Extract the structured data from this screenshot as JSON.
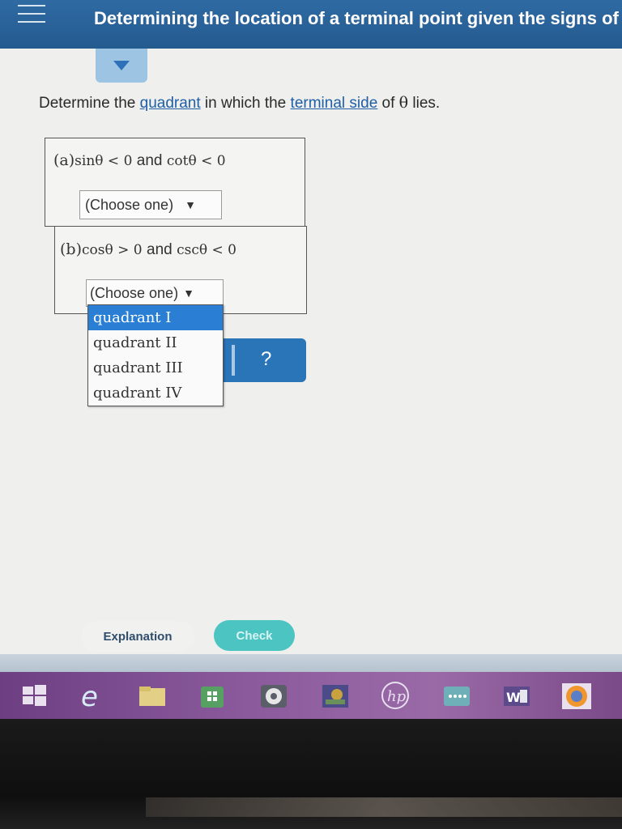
{
  "header": {
    "title": "Determining the location of a terminal point given the signs of"
  },
  "question": {
    "prefix": "Determine the ",
    "link1": "quadrant",
    "middle": " in which the ",
    "link2": "terminal side",
    "suffix_pre": " of ",
    "theta": "θ",
    "suffix": " lies."
  },
  "parts": [
    {
      "label": "(a)",
      "cond1_fn": "sinθ",
      "cond1_op": " < 0 ",
      "and": "and",
      "cond2_fn": " cotθ",
      "cond2_op": " < 0",
      "select_value": "(Choose one)"
    },
    {
      "label": "(b)",
      "cond1_fn": "cosθ",
      "cond1_op": " > 0 ",
      "and": "and",
      "cond2_fn": " cscθ",
      "cond2_op": " < 0",
      "select_value": "(Choose one)"
    }
  ],
  "dropdown_options": [
    "quadrant I",
    "quadrant II",
    "quadrant III",
    "quadrant IV"
  ],
  "help_label": "?",
  "buttons": {
    "explanation": "Explanation",
    "check": "Check"
  },
  "taskbar": {
    "icons": [
      "windows-start",
      "edge",
      "file-explorer",
      "store",
      "media-player",
      "photos",
      "hp",
      "network",
      "word",
      "firefox"
    ],
    "word_letter": "W",
    "hp_text": "hp",
    "edge_letter": "e"
  },
  "colors": {
    "header_blue": "#245b8f",
    "link_blue": "#1e5fa6",
    "selected_option": "#2a7fd4",
    "check_teal": "#4cc5c2"
  }
}
